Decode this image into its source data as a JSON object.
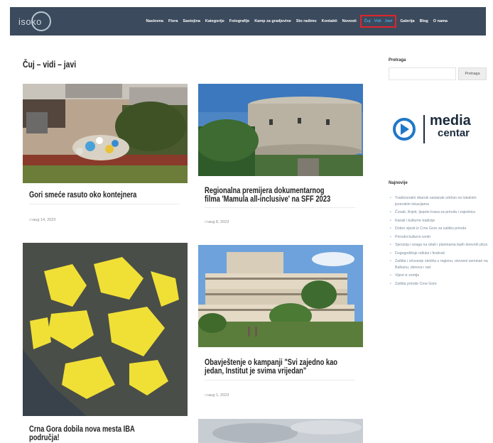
{
  "header": {
    "logo_text": "isoko",
    "nav_items": [
      "Naslovna",
      "Flora",
      "Sastojina",
      "Kategorije",
      "Fotografije",
      "Kamp za gradjevine",
      "Sto radimo",
      "Kontakti",
      "Novosti"
    ],
    "highlight_items": [
      "Čuj",
      "Vidi",
      "Javi"
    ],
    "nav_items_right": [
      "Galerija",
      "Blog",
      "O nama"
    ],
    "colors": {
      "bar": "#3b4a5c",
      "highlight_border": "#e0242c",
      "highlight_text": "#4fa3e0"
    }
  },
  "page": {
    "title": "Čuj – vidi – javi"
  },
  "posts": [
    {
      "title_lines": [
        "Gori smeće rasuto oko kontejnera"
      ],
      "date": "aug 14, 2023"
    },
    {
      "title_lines": [
        "Regionalna premijera dokumentarnog",
        "filma 'Mamula all-inclusive' na SFF 2023"
      ],
      "date": "aug 8, 2023"
    },
    {
      "title_lines": [
        "Crna Gora dobila nova mesta IBA",
        "područja!"
      ],
      "date": ""
    },
    {
      "title_lines": [
        "Obavještenje o kampanji \"Svi zajedno kao",
        "jedan, Institut je svima vrijedan\""
      ],
      "date": "aug 1, 2023"
    }
  ],
  "sidebar": {
    "search_label": "Pretraga",
    "search_placeholder": "",
    "search_button": "Pretraga",
    "media_centar": {
      "line1": "media",
      "line2": "centar",
      "brand_color": "#1f78c8"
    },
    "recent_heading": "Najnovije",
    "recent_posts": [
      "Tradicionalni ribarski sastanak održan na lokalnim jezerskim lokacijama",
      "Čuvati, živjeti, ljepote krasa za prirodu i zajednicu",
      "Kanali i kulturne tradicije",
      "Dobre vijesti iz Crne Gore za zaštitu prirode",
      "Prirodni kulturni centri",
      "Sjećanja i snaga na obali i planinama lepih dnevnih ptica",
      "Dugogodišnje odluke i festivali",
      "Zaštita i očuvanje okoliša u regionu, otvoreni seminari na Balkanu, obnova i rad",
      "Vijest iz zemlje",
      "Zaštita prirode Crne Gore"
    ]
  }
}
